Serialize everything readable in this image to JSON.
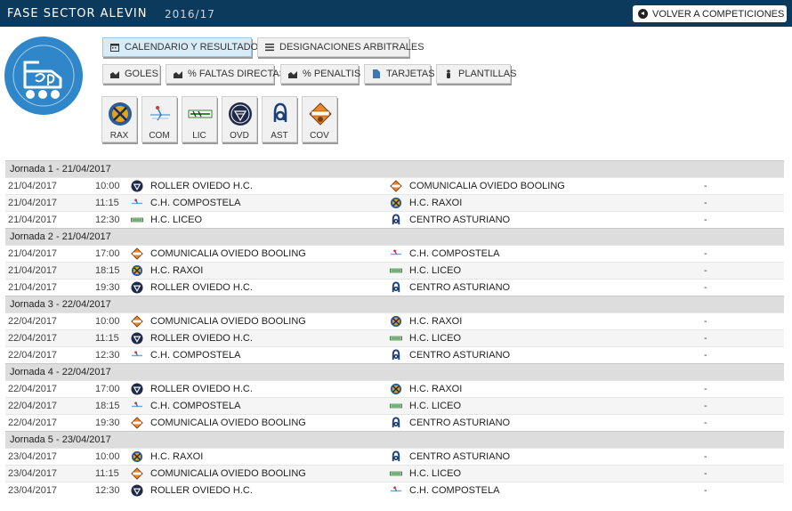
{
  "header": {
    "title": "FASE SECTOR ALEVIN",
    "season": "2016/17",
    "back_label": "VOLVER A COMPETICIONES"
  },
  "tabs_row1": [
    {
      "label": "CALENDARIO Y RESULTADOS",
      "icon": "calendar-icon",
      "active": true
    },
    {
      "label": "DESIGNACIONES ARBITRALES",
      "icon": "list-icon",
      "active": false
    }
  ],
  "tabs_row2": [
    {
      "label": "GOLES",
      "icon": "area-chart-icon"
    },
    {
      "label": "% FALTAS DIRECTAS",
      "icon": "area-chart-icon"
    },
    {
      "label": "% PENALTIS",
      "icon": "area-chart-icon"
    },
    {
      "label": "TARJETAS",
      "icon": "card-icon"
    },
    {
      "label": "PLANTILLAS",
      "icon": "person-icon"
    }
  ],
  "teams": [
    {
      "abbr": "RAX",
      "name": "H.C. RAXOI"
    },
    {
      "abbr": "COM",
      "name": "C.H. COMPOSTELA"
    },
    {
      "abbr": "LIC",
      "name": "H.C. LICEO"
    },
    {
      "abbr": "OVD",
      "name": "ROLLER OVIEDO H.C."
    },
    {
      "abbr": "AST",
      "name": "CENTRO ASTURIANO"
    },
    {
      "abbr": "COV",
      "name": "COMUNICALIA OVIEDO BOOLING"
    }
  ],
  "colors": {
    "header_bg": "#0b3a5c",
    "federation_blue": "#2f86c8",
    "jornada_bg": "#dddddd"
  },
  "jornadas": [
    {
      "label": "Jornada 1 - 21/04/2017",
      "matches": [
        {
          "date": "21/04/2017",
          "time": "10:00",
          "home": "ROLLER OVIEDO H.C.",
          "home_abbr": "OVD",
          "away": "COMUNICALIA OVIEDO BOOLING",
          "away_abbr": "COV",
          "result": "-"
        },
        {
          "date": "21/04/2017",
          "time": "11:15",
          "home": "C.H. COMPOSTELA",
          "home_abbr": "COM",
          "away": "H.C. RAXOI",
          "away_abbr": "RAX",
          "result": "-"
        },
        {
          "date": "21/04/2017",
          "time": "12:30",
          "home": "H.C. LICEO",
          "home_abbr": "LIC",
          "away": "CENTRO ASTURIANO",
          "away_abbr": "AST",
          "result": "-"
        }
      ]
    },
    {
      "label": "Jornada 2 - 21/04/2017",
      "matches": [
        {
          "date": "21/04/2017",
          "time": "17:00",
          "home": "COMUNICALIA OVIEDO BOOLING",
          "home_abbr": "COV",
          "away": "C.H. COMPOSTELA",
          "away_abbr": "COM",
          "result": "-"
        },
        {
          "date": "21/04/2017",
          "time": "18:15",
          "home": "H.C. RAXOI",
          "home_abbr": "RAX",
          "away": "H.C. LICEO",
          "away_abbr": "LIC",
          "result": "-"
        },
        {
          "date": "21/04/2017",
          "time": "19:30",
          "home": "ROLLER OVIEDO H.C.",
          "home_abbr": "OVD",
          "away": "CENTRO ASTURIANO",
          "away_abbr": "AST",
          "result": "-"
        }
      ]
    },
    {
      "label": "Jornada 3 - 22/04/2017",
      "matches": [
        {
          "date": "22/04/2017",
          "time": "10:00",
          "home": "COMUNICALIA OVIEDO BOOLING",
          "home_abbr": "COV",
          "away": "H.C. RAXOI",
          "away_abbr": "RAX",
          "result": "-"
        },
        {
          "date": "22/04/2017",
          "time": "11:15",
          "home": "ROLLER OVIEDO H.C.",
          "home_abbr": "OVD",
          "away": "H.C. LICEO",
          "away_abbr": "LIC",
          "result": "-"
        },
        {
          "date": "22/04/2017",
          "time": "12:30",
          "home": "C.H. COMPOSTELA",
          "home_abbr": "COM",
          "away": "CENTRO ASTURIANO",
          "away_abbr": "AST",
          "result": "-"
        }
      ]
    },
    {
      "label": "Jornada 4 - 22/04/2017",
      "matches": [
        {
          "date": "22/04/2017",
          "time": "17:00",
          "home": "ROLLER OVIEDO H.C.",
          "home_abbr": "OVD",
          "away": "H.C. RAXOI",
          "away_abbr": "RAX",
          "result": "-"
        },
        {
          "date": "22/04/2017",
          "time": "18:15",
          "home": "C.H. COMPOSTELA",
          "home_abbr": "COM",
          "away": "H.C. LICEO",
          "away_abbr": "LIC",
          "result": "-"
        },
        {
          "date": "22/04/2017",
          "time": "19:30",
          "home": "COMUNICALIA OVIEDO BOOLING",
          "home_abbr": "COV",
          "away": "CENTRO ASTURIANO",
          "away_abbr": "AST",
          "result": "-"
        }
      ]
    },
    {
      "label": "Jornada 5 - 23/04/2017",
      "matches": [
        {
          "date": "23/04/2017",
          "time": "10:00",
          "home": "H.C. RAXOI",
          "home_abbr": "RAX",
          "away": "CENTRO ASTURIANO",
          "away_abbr": "AST",
          "result": "-"
        },
        {
          "date": "23/04/2017",
          "time": "11:15",
          "home": "COMUNICALIA OVIEDO BOOLING",
          "home_abbr": "COV",
          "away": "H.C. LICEO",
          "away_abbr": "LIC",
          "result": "-"
        },
        {
          "date": "23/04/2017",
          "time": "12:30",
          "home": "ROLLER OVIEDO H.C.",
          "home_abbr": "OVD",
          "away": "C.H. COMPOSTELA",
          "away_abbr": "COM",
          "result": "-"
        }
      ]
    }
  ]
}
